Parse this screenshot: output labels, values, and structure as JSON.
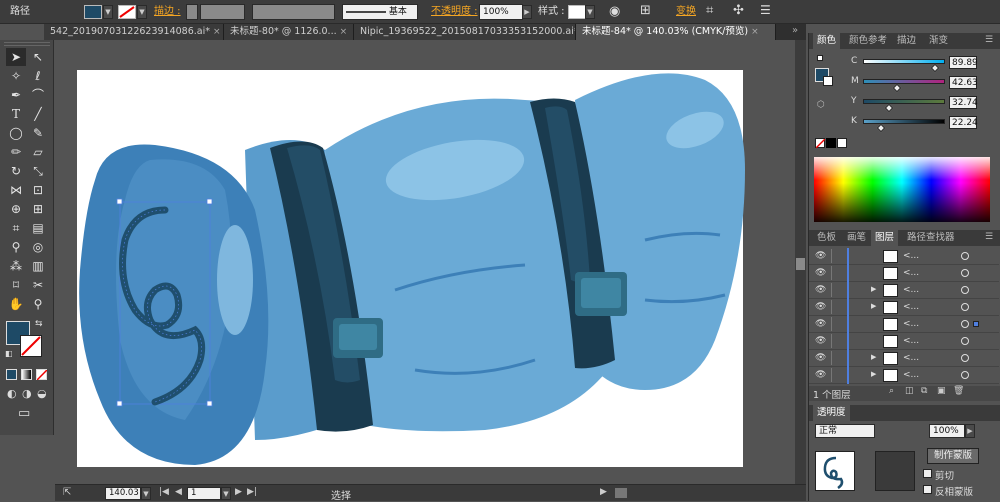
{
  "control_bar": {
    "object_type": "路径",
    "stroke_label": "描边 :",
    "stroke_style": "基本",
    "opacity_label": "不透明度 :",
    "opacity_value": "100%",
    "style_label": "样式 :",
    "transform_label": "变换",
    "fill_color": "#1e4a66"
  },
  "tabs": [
    {
      "label": "542_20190703122623914086.ai*",
      "close": "×"
    },
    {
      "label": "未标题-80* @ 1126.0...",
      "close": "×"
    },
    {
      "label": "Nipic_19369522_20150817033353152000.ai*",
      "close": "×"
    },
    {
      "label": "未标题-84* @ 140.03% (CMYK/预览)",
      "close": "×"
    }
  ],
  "status_bar": {
    "zoom": "140.03",
    "page": "1",
    "tool_status": "选择"
  },
  "color_panel": {
    "tabs": [
      "颜色",
      "颜色参考",
      "描边",
      "渐变"
    ],
    "channels": [
      {
        "label": "C",
        "value": "89.89",
        "fraction": 0.8989
      },
      {
        "label": "M",
        "value": "42.63",
        "fraction": 0.4263
      },
      {
        "label": "Y",
        "value": "32.74",
        "fraction": 0.3274
      },
      {
        "label": "K",
        "value": "22.24",
        "fraction": 0.2224
      }
    ]
  },
  "layers_panel": {
    "tabs": [
      "色板",
      "画笔",
      "图层",
      "路径查找器"
    ],
    "rows": [
      {
        "name": "<...",
        "expand": ""
      },
      {
        "name": "<...",
        "expand": ""
      },
      {
        "name": "<...",
        "expand": "▶"
      },
      {
        "name": "<...",
        "expand": "▶"
      },
      {
        "name": "<...",
        "expand": ""
      },
      {
        "name": "<...",
        "expand": ""
      },
      {
        "name": "<...",
        "expand": "▶"
      },
      {
        "name": "<...",
        "expand": "▶"
      }
    ],
    "footer_count": "1 个图层"
  },
  "transparency_panel": {
    "title": "透明度",
    "mode": "正常",
    "opacity": "100%",
    "make_mask_button": "制作蒙版",
    "clip_label": "剪切",
    "invert_label": "反相蒙版"
  },
  "colors": {
    "bag_main": "#6aaad6",
    "bag_dark": "#3d80b8",
    "bag_light": "#8cc3e6",
    "strap": "#1a3b4f",
    "strap_dark": "#0f2533",
    "buckle": "#2f6c85",
    "swirl": "#1f4f6e"
  }
}
